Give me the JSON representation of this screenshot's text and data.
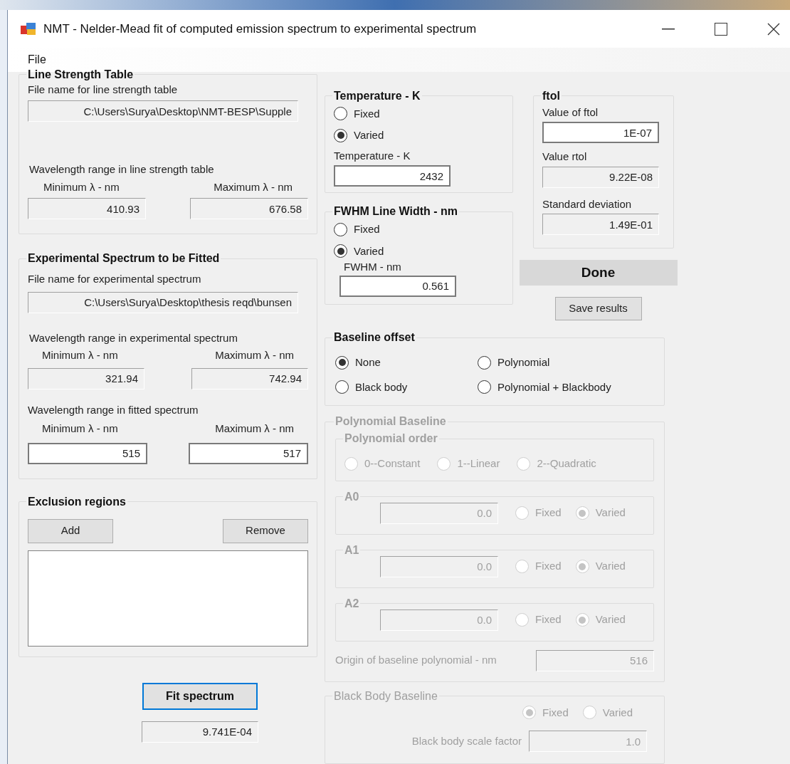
{
  "window": {
    "title": "NMT - Nelder-Mead fit of computed emission spectrum to experimental spectrum"
  },
  "menu": [
    {
      "label": "File"
    }
  ],
  "line_strength_table": {
    "title": "Line Strength Table",
    "file_label": "File name for line strength table",
    "file": {
      "value": "C:\\Users\\Surya\\Desktop\\NMT-BESP\\Supple",
      "editable": false
    },
    "range_label": "Wavelength range in line strength table",
    "min_label": "Minimum λ  - nm",
    "min": {
      "value": "410.93",
      "editable": false
    },
    "max_label": "Maximum λ  - nm",
    "max": {
      "value": "676.58",
      "editable": false
    }
  },
  "experimental_spectrum": {
    "title": "Experimental Spectrum to be Fitted",
    "file_label": "File name for experimental spectrum",
    "file": {
      "value": "C:\\Users\\Surya\\Desktop\\thesis reqd\\bunsen",
      "editable": false
    },
    "range_label": "Wavelength range in experimental spectrum",
    "min_label": "Minimum λ  - nm",
    "min": {
      "value": "321.94",
      "editable": false
    },
    "max_label": "Maximum λ  - nm",
    "max": {
      "value": "742.94",
      "editable": false
    },
    "fitted_range_label": "Wavelength range in fitted spectrum",
    "fitted_min_label": "Minimum λ  - nm",
    "fitted_min": {
      "value": "515",
      "editable": true
    },
    "fitted_max_label": "Maximum λ  - nm",
    "fitted_max": {
      "value": "517",
      "editable": true
    }
  },
  "exclusion_regions": {
    "title": "Exclusion regions",
    "add_button": "Add",
    "remove_button": "Remove"
  },
  "fit_button": "Fit spectrum",
  "fit_result": {
    "value": "9.741E-04",
    "editable": false
  },
  "temperature": {
    "title": "Temperature - K",
    "options": [
      {
        "label": "Fixed",
        "selected": false
      },
      {
        "label": "Varied",
        "selected": true
      }
    ],
    "value_label": "Temperature - K",
    "value": {
      "value": "2432",
      "editable": true
    }
  },
  "fwhm": {
    "title": "FWHM Line Width - nm",
    "options": [
      {
        "label": "Fixed",
        "selected": false
      },
      {
        "label": "Varied",
        "selected": true
      }
    ],
    "value_label": "FWHM - nm",
    "value": {
      "value": "0.561",
      "editable": true
    }
  },
  "ftol": {
    "title": "ftol",
    "ftol_label": "Value of ftol",
    "ftol": {
      "value": "1E-07",
      "editable": true
    },
    "rtol_label": "Value rtol",
    "rtol": {
      "value": "9.22E-08",
      "editable": false
    },
    "std_label": "Standard deviation",
    "std": {
      "value": "1.49E-01",
      "editable": false
    }
  },
  "status": "Done",
  "save_button": "Save results",
  "baseline_offset": {
    "title": "Baseline offset",
    "options": [
      {
        "label": "None",
        "selected": true
      },
      {
        "label": "Polynomial",
        "selected": false
      },
      {
        "label": "Black body",
        "selected": false
      },
      {
        "label": "Polynomial + Blackbody",
        "selected": false
      }
    ]
  },
  "polynomial_baseline": {
    "title": "Polynomial Baseline",
    "disabled": true,
    "order_title": "Polynomial order",
    "orders": [
      {
        "label": "0--Constant",
        "selected": false
      },
      {
        "label": "1--Linear",
        "selected": false
      },
      {
        "label": "2--Quadratic",
        "selected": false
      }
    ],
    "coefficients": [
      {
        "name": "A0",
        "value": {
          "value": "0.0",
          "editable": false
        },
        "options": [
          {
            "label": "Fixed",
            "selected": false
          },
          {
            "label": "Varied",
            "selected": true
          }
        ]
      },
      {
        "name": "A1",
        "value": {
          "value": "0.0",
          "editable": false
        },
        "options": [
          {
            "label": "Fixed",
            "selected": false
          },
          {
            "label": "Varied",
            "selected": true
          }
        ]
      },
      {
        "name": "A2",
        "value": {
          "value": "0.0",
          "editable": false
        },
        "options": [
          {
            "label": "Fixed",
            "selected": false
          },
          {
            "label": "Varied",
            "selected": true
          }
        ]
      }
    ],
    "origin_label": "Origin of baseline polynomial - nm",
    "origin": {
      "value": "516",
      "editable": false
    }
  },
  "black_body_baseline": {
    "title": "Black Body Baseline",
    "disabled": true,
    "options": [
      {
        "label": "Fixed",
        "selected": true
      },
      {
        "label": "Varied",
        "selected": false
      }
    ],
    "scale_label": "Black body scale factor",
    "scale": {
      "value": "1.0",
      "editable": false
    }
  }
}
